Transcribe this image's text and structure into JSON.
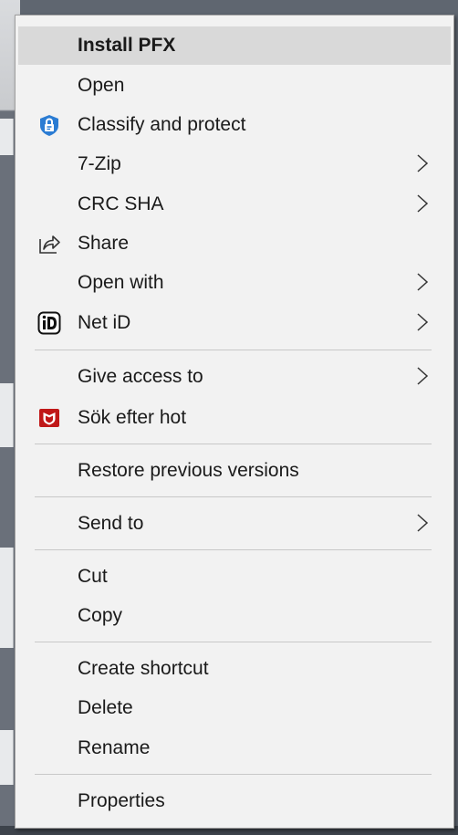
{
  "menu": {
    "items": [
      {
        "label": "Install PFX"
      },
      {
        "label": "Open"
      },
      {
        "label": "Classify and protect",
        "icon": "lock-shield-icon"
      },
      {
        "label": "7-Zip",
        "submenu": true
      },
      {
        "label": "CRC SHA",
        "submenu": true
      },
      {
        "label": "Share",
        "icon": "share-icon"
      },
      {
        "label": "Open with",
        "submenu": true
      },
      {
        "label": "Net iD",
        "icon": "netid-icon",
        "submenu": true
      },
      {
        "label": "Give access to",
        "submenu": true
      },
      {
        "label": "Sök efter hot",
        "icon": "mcafee-shield-icon"
      },
      {
        "label": "Restore previous versions"
      },
      {
        "label": "Send to",
        "submenu": true
      },
      {
        "label": "Cut"
      },
      {
        "label": "Copy"
      },
      {
        "label": "Create shortcut"
      },
      {
        "label": "Delete"
      },
      {
        "label": "Rename"
      },
      {
        "label": "Properties"
      }
    ],
    "highlighted_item": "Install PFX"
  },
  "colors": {
    "menu_background": "#f2f2f2",
    "highlight": "#d9d9d9",
    "separator": "#c8c8c8",
    "text": "#1a1a1a",
    "aip_blue": "#2b7cd3",
    "mcafee_red": "#c01818"
  }
}
